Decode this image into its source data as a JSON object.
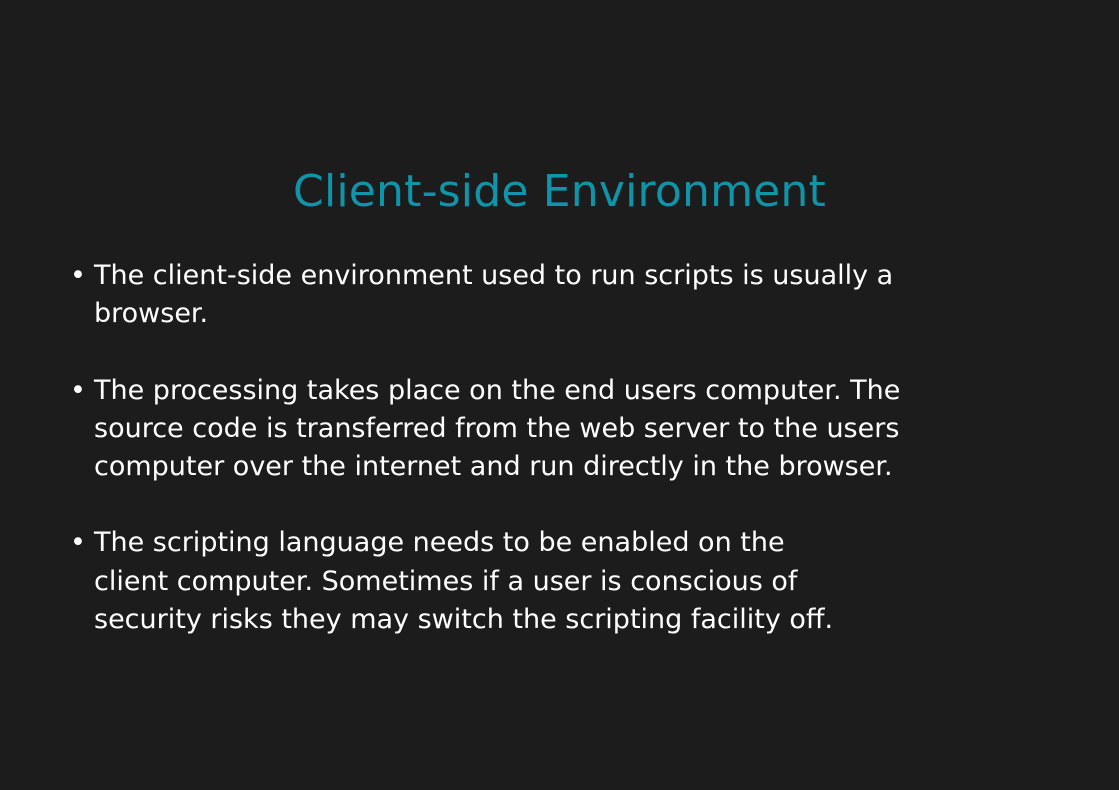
{
  "slide": {
    "title": "Client-side Environment",
    "accent_color": "#0f95aa",
    "background_color": "#1c1c1c",
    "bullet_symbol": "•",
    "bullets": [
      {
        "lines": [
          "The client-side environment used to run scripts is usually a",
          "browser."
        ]
      },
      {
        "lines": [
          "The processing takes place on the end users computer. The",
          "source code is transferred from the web server to the users",
          "computer over the internet and run directly in the browser."
        ]
      },
      {
        "lines": [
          "The scripting language needs to be enabled on the",
          "client computer. Sometimes if a user is conscious of",
          "security risks they may switch the scripting facility off."
        ]
      }
    ]
  }
}
